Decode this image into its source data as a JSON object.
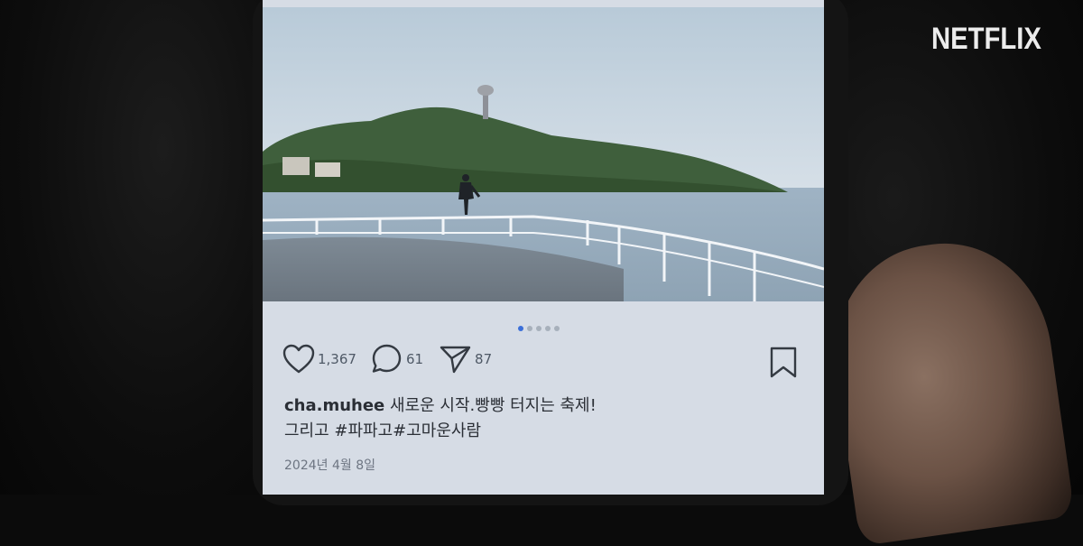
{
  "brand": {
    "logo_text": "NETFLIX"
  },
  "post": {
    "image_count": 5,
    "active_image": 1,
    "likes": "1,367",
    "comments": "61",
    "shares": "87",
    "username": "cha.muhee",
    "caption_line1": "새로운 시작.빵빵 터지는 축제!",
    "caption_line2": "그리고 #파파고#고마운사람",
    "date": "2024년 4월 8일"
  },
  "icons": {
    "like": "heart-icon",
    "comment": "comment-bubble-icon",
    "share": "paper-plane-icon",
    "save": "bookmark-icon"
  },
  "colors": {
    "accent_dot": "#3b6fd8",
    "screen_bg": "#d6dce5",
    "brand_text": "#ececec"
  }
}
